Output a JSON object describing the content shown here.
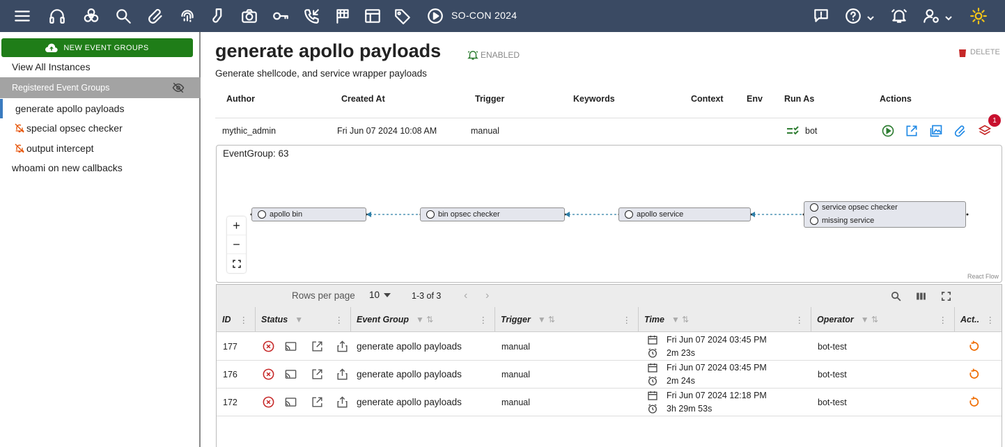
{
  "topbar": {
    "title": "SO-CON 2024",
    "icons": [
      "menu-icon",
      "headphones-icon",
      "biohazard-icon",
      "search-icon",
      "paperclip-icon",
      "fingerprint-icon",
      "socks-icon",
      "camera-icon",
      "key-icon",
      "phone-callback-icon",
      "checkered-flag-icon",
      "table-icon",
      "tag-icon",
      "play-circle-icon",
      "feedback-icon",
      "help-icon",
      "bell-icon",
      "user-settings-icon",
      "sun-icon"
    ]
  },
  "sidebar": {
    "new_button": "NEW EVENT GROUPS",
    "view_all": "View All Instances",
    "section_title": "Registered Event Groups",
    "items": [
      {
        "label": "generate apollo payloads",
        "active": true,
        "muted": false
      },
      {
        "label": "special opsec checker",
        "active": false,
        "muted": true
      },
      {
        "label": "output intercept",
        "active": false,
        "muted": true
      },
      {
        "label": "whoami on new callbacks",
        "active": false,
        "muted": false
      }
    ]
  },
  "header": {
    "title": "generate apollo payloads",
    "status": "ENABLED",
    "delete_label": "DELETE",
    "description": "Generate shellcode, and service wrapper payloads"
  },
  "info": {
    "columns": [
      "Author",
      "Created At",
      "Trigger",
      "Keywords",
      "Context",
      "Env",
      "Run As",
      "Actions"
    ],
    "author": "mythic_admin",
    "created_at": "Fri Jun 07 2024 10:08 AM",
    "trigger": "manual",
    "run_as": "bot",
    "badge_count": "1"
  },
  "flow": {
    "label": "EventGroup: 63",
    "nodes": [
      "apollo bin",
      "bin opsec checker",
      "apollo service"
    ],
    "multi_node": [
      "service opsec checker",
      "missing service"
    ],
    "attribution": "React Flow"
  },
  "table": {
    "rows_per_page_label": "Rows per page",
    "rows_per_page": "10",
    "range": "1-3 of 3",
    "headers": [
      "ID",
      "Status",
      "Event Group",
      "Trigger",
      "Time",
      "Operator",
      "Act.."
    ],
    "rows": [
      {
        "id": "177",
        "event_group": "generate apollo payloads",
        "trigger": "manual",
        "time": "Fri Jun 07 2024 03:45 PM",
        "duration": "2m 23s",
        "operator": "bot-test"
      },
      {
        "id": "176",
        "event_group": "generate apollo payloads",
        "trigger": "manual",
        "time": "Fri Jun 07 2024 03:45 PM",
        "duration": "2m 24s",
        "operator": "bot-test"
      },
      {
        "id": "172",
        "event_group": "generate apollo payloads",
        "trigger": "manual",
        "time": "Fri Jun 07 2024 12:18 PM",
        "duration": "3h 29m 53s",
        "operator": "bot-test"
      }
    ]
  },
  "colors": {
    "topbar": "#3a4a63",
    "new_button": "#1f7d18",
    "delete": "#c62828",
    "action_blue": "#1e88e5",
    "replay_orange": "#ef6c00",
    "error_red": "#c62828"
  }
}
